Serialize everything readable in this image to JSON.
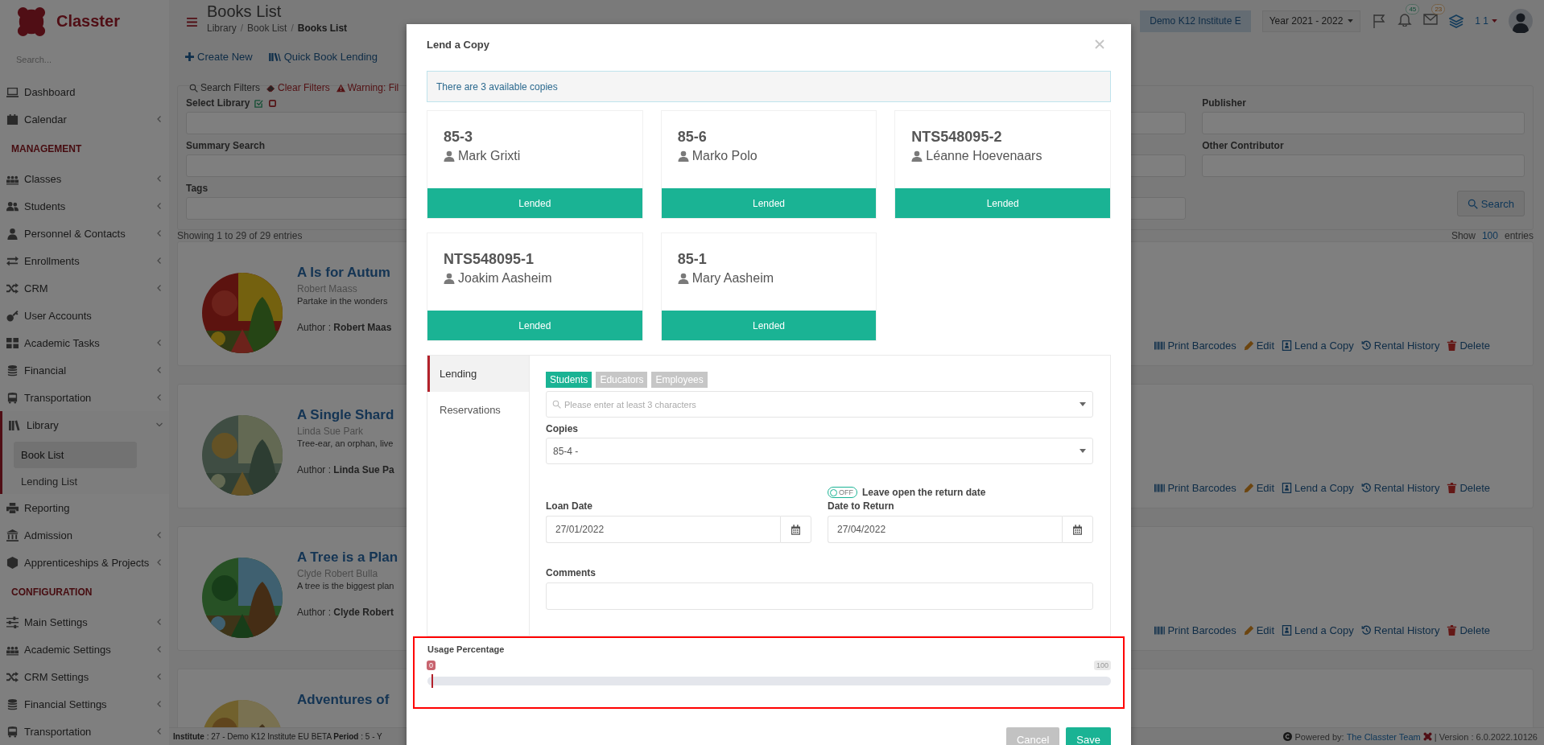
{
  "sidebar": {
    "logo_text": "Classter",
    "search": {
      "placeholder": "Search..."
    },
    "items": [
      {
        "kind": "item",
        "label": "Dashboard",
        "expandable": false
      },
      {
        "kind": "item",
        "label": "Calendar",
        "expandable": true,
        "expanded": false
      },
      {
        "kind": "heading",
        "label": "MANAGEMENT"
      },
      {
        "kind": "item",
        "label": "Classes",
        "expandable": true,
        "expanded": false
      },
      {
        "kind": "item",
        "label": "Students",
        "expandable": true,
        "expanded": false
      },
      {
        "kind": "item",
        "label": "Personnel & Contacts",
        "expandable": true,
        "expanded": false
      },
      {
        "kind": "item",
        "label": "Enrollments",
        "expandable": true,
        "expanded": false
      },
      {
        "kind": "item",
        "label": "CRM",
        "expandable": true,
        "expanded": false
      },
      {
        "kind": "item",
        "label": "User Accounts",
        "expandable": false
      },
      {
        "kind": "item",
        "label": "Academic Tasks",
        "expandable": true,
        "expanded": false
      },
      {
        "kind": "item",
        "label": "Financial",
        "expandable": true,
        "expanded": false
      },
      {
        "kind": "item",
        "label": "Transportation",
        "expandable": true,
        "expanded": false
      },
      {
        "kind": "item",
        "label": "Library",
        "expandable": true,
        "expanded": true,
        "children": [
          {
            "label": "Book List",
            "selected": true
          },
          {
            "label": "Lending List",
            "selected": false
          }
        ]
      },
      {
        "kind": "item",
        "label": "Reporting",
        "expandable": false
      },
      {
        "kind": "item",
        "label": "Admission",
        "expandable": true,
        "expanded": false
      },
      {
        "kind": "item",
        "label": "Apprenticeships & Projects",
        "expandable": true,
        "expanded": false
      },
      {
        "kind": "heading",
        "label": "CONFIGURATION"
      },
      {
        "kind": "item",
        "label": "Main Settings",
        "expandable": true,
        "expanded": false
      },
      {
        "kind": "item",
        "label": "Academic Settings",
        "expandable": true,
        "expanded": false
      },
      {
        "kind": "item",
        "label": "CRM Settings",
        "expandable": true,
        "expanded": false
      },
      {
        "kind": "item",
        "label": "Financial Settings",
        "expandable": true,
        "expanded": false
      },
      {
        "kind": "item",
        "label": "Transportation",
        "expandable": true,
        "expanded": false
      }
    ]
  },
  "header": {
    "title": "Books List",
    "separator": "/",
    "breadcrumb": [
      {
        "label": "Library",
        "current": false
      },
      {
        "label": "Book List",
        "current": false
      },
      {
        "label": "Books List",
        "current": true
      }
    ],
    "institute": "Demo K12 Institute E",
    "year": "Year 2021 - 2022",
    "notifications": "45",
    "messages": "23",
    "user": "1 1"
  },
  "toolbar": [
    "Create New",
    "Quick Book Lending"
  ],
  "filters": {
    "search_filters": "Search Filters",
    "clear_filters": "Clear Filters",
    "warning": "Warning: Fil",
    "left_labels": [
      "Select Library",
      "Summary Search",
      "Tags"
    ],
    "right_labels": [
      "Publisher",
      "Other Contributor"
    ],
    "search_button": "Search"
  },
  "list": {
    "summary": "Showing 1 to 29 of 29 entries",
    "show_label": "Show",
    "page_size": "100",
    "entries_label": "entries"
  },
  "books": [
    {
      "kind": "picture",
      "title": "A Is for Autum",
      "author": "Robert Maass",
      "description": "Partake in the wonders",
      "author_line": "Author : **Robert Maas**",
      "actions": [
        "Print Barcodes",
        "Edit",
        "Lend a Copy",
        "Rental History",
        "Delete"
      ]
    },
    {
      "kind": "picture",
      "title": "A Single Shard",
      "author": "Linda Sue Park",
      "description": "Tree-ear, an orphan, live",
      "author_line": "Author : **Linda Sue Pa**",
      "actions": [
        "Print Barcodes",
        "Edit",
        "Lend a Copy",
        "Rental History",
        "Delete"
      ]
    },
    {
      "kind": "picture",
      "title": "A Tree is a Plan",
      "author": "Clyde Robert Bulla",
      "description": "A tree is the biggest plan",
      "author_line": "Author : **Clyde Robert**",
      "actions": [
        "Print Barcodes",
        "Edit",
        "Lend a Copy",
        "Rental History",
        "Delete"
      ]
    },
    {
      "kind": "picture",
      "title": "Adventures of"
    }
  ],
  "footer": {
    "info": "**Institute** : 27 - Demo K12 Institute EU BETA **Period** : 5 - Y",
    "powered": "Powered by:",
    "team": "The Classter Team",
    "version": "| Version : 6.0.2022.10126"
  },
  "modal": {
    "title": "Lend a Copy",
    "alert": "There are 3 available copies",
    "copies": [
      {
        "code": "85-3",
        "borrower": "Mark Grixti",
        "status": "Lended"
      },
      {
        "code": "85-6",
        "borrower": "Marko Polo",
        "status": "Lended"
      },
      {
        "code": "NTS548095-2",
        "borrower": "Léanne Hoevenaars",
        "status": "Lended"
      },
      {
        "code": "NTS548095-1",
        "borrower": "Joakim Aasheim",
        "status": "Lended"
      },
      {
        "code": "85-1",
        "borrower": "Mary Aasheim",
        "status": "Lended"
      }
    ],
    "tabs": [
      {
        "label": "Lending",
        "selected": true
      },
      {
        "label": "Reservations",
        "selected": false
      }
    ],
    "borrower_types": [
      {
        "label": "Students",
        "selected": true
      },
      {
        "label": "Educators",
        "selected": false
      },
      {
        "label": "Employees",
        "selected": false
      }
    ],
    "borrower_search": {
      "placeholder": "Please enter at least 3 characters"
    },
    "copies_field": {
      "label": "Copies",
      "value": "85-4 -"
    },
    "leave_open": {
      "on": false,
      "state_label": "OFF",
      "label": "Leave open the return date"
    },
    "loan_date": {
      "label": "Loan Date",
      "value": "27/01/2022"
    },
    "return_date": {
      "label": "Date to Return",
      "value": "27/04/2022"
    },
    "comments": {
      "label": "Comments"
    },
    "usage": {
      "label": "Usage Percentage",
      "value": "0",
      "max": "100",
      "level": 0
    },
    "buttons": [
      {
        "label": "Cancel",
        "kind": "secondary"
      },
      {
        "label": "Save",
        "kind": "primary"
      }
    ]
  }
}
